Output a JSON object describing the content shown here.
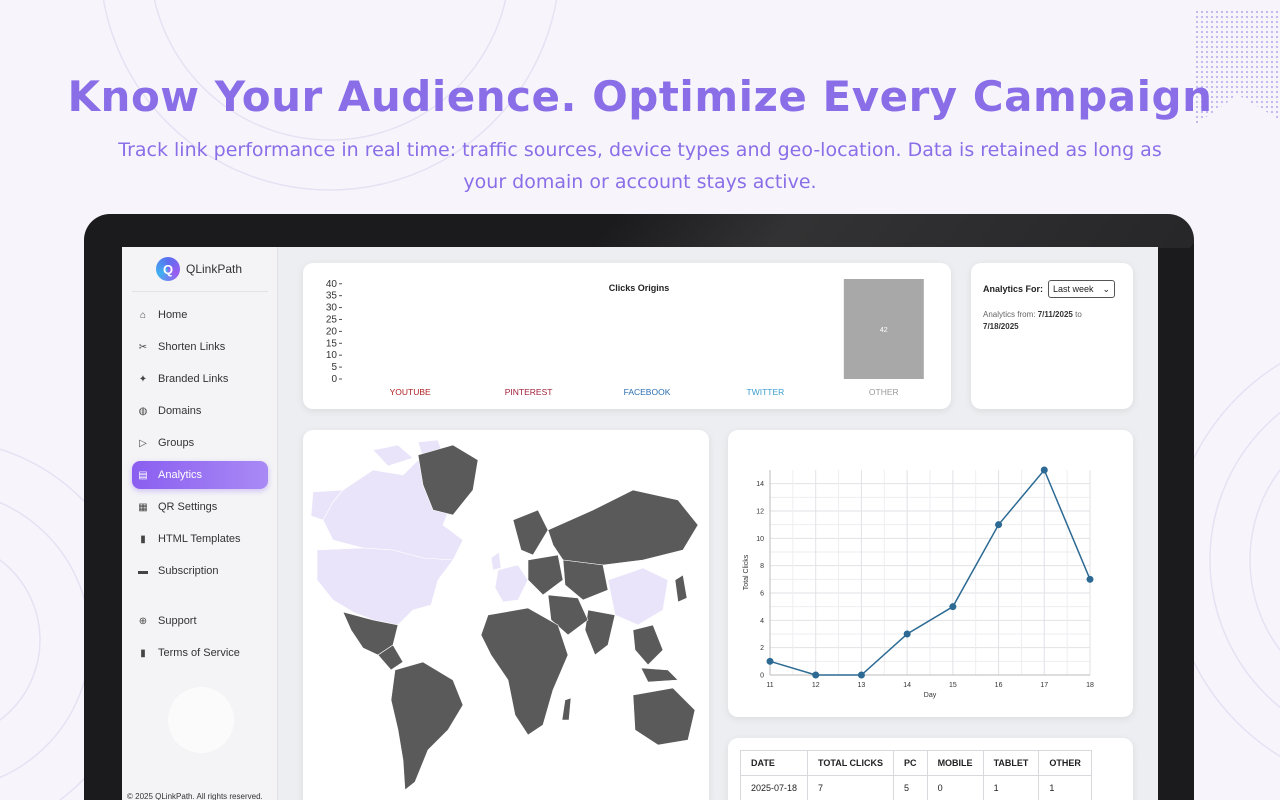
{
  "hero": {
    "title": "Know Your Audience. Optimize Every Campaign",
    "subtitle": "Track link performance in real time: traffic sources, device types and geo-location. Data is retained as long as your domain or account stays active."
  },
  "brand": {
    "logo_letter": "Q",
    "name": "QLinkPath"
  },
  "sidebar": {
    "items": [
      {
        "label": "Home",
        "icon": "home-icon",
        "glyph": "⌂"
      },
      {
        "label": "Shorten Links",
        "icon": "scissors-icon",
        "glyph": "✂"
      },
      {
        "label": "Branded Links",
        "icon": "magic-wand-icon",
        "glyph": "✦"
      },
      {
        "label": "Domains",
        "icon": "globe-icon",
        "glyph": "◍"
      },
      {
        "label": "Groups",
        "icon": "tag-icon",
        "glyph": "▷"
      },
      {
        "label": "Analytics",
        "icon": "chart-icon",
        "glyph": "▤"
      },
      {
        "label": "QR Settings",
        "icon": "qr-icon",
        "glyph": "▦"
      },
      {
        "label": "HTML Templates",
        "icon": "file-icon",
        "glyph": "▮"
      },
      {
        "label": "Subscription",
        "icon": "card-icon",
        "glyph": "▬"
      }
    ],
    "secondary": [
      {
        "label": "Support",
        "icon": "lifebuoy-icon",
        "glyph": "⊕"
      },
      {
        "label": "Terms of Service",
        "icon": "document-icon",
        "glyph": "▮"
      }
    ],
    "active": "Analytics",
    "footer": "© 2025 QLinkPath. All rights reserved."
  },
  "filter": {
    "label": "Analytics For:",
    "selected": "Last week",
    "range_prefix": "Analytics from:",
    "from": "7/11/2025",
    "to_word": "to",
    "to": "7/18/2025"
  },
  "chart_data": [
    {
      "type": "bar",
      "title": "Clicks Origins",
      "categories": [
        "YOUTUBE",
        "PINTEREST",
        "FACEBOOK",
        "TWITTER",
        "OTHER"
      ],
      "category_colors": [
        "#b02020",
        "#a0203a",
        "#2a6db0",
        "#3a9ed0",
        "#9a9a9a"
      ],
      "values": [
        0,
        0,
        0,
        0,
        42
      ],
      "data_labels": [
        "",
        "",
        "",
        "",
        "42"
      ],
      "yticks": [
        0,
        5,
        10,
        15,
        20,
        25,
        30,
        35,
        40
      ],
      "ylim": [
        0,
        42
      ],
      "bar_color": "#a8a8a8"
    },
    {
      "type": "line",
      "x": [
        11,
        12,
        13,
        14,
        15,
        16,
        17,
        18
      ],
      "series": [
        {
          "values": [
            1,
            0,
            0,
            3,
            5,
            11,
            15,
            7
          ]
        }
      ],
      "xlabel": "Day",
      "ylabel": "Total Clicks",
      "yticks": [
        0,
        2,
        4,
        6,
        8,
        10,
        12,
        14
      ],
      "ylim": [
        0,
        15
      ],
      "grid": true,
      "line_color": "#2c6a93"
    }
  ],
  "table": {
    "headers": [
      "DATE",
      "TOTAL CLICKS",
      "PC",
      "MOBILE",
      "TABLET",
      "OTHER"
    ],
    "rows": [
      [
        "2025-07-18",
        "7",
        "5",
        "0",
        "1",
        "1"
      ]
    ]
  },
  "map": {
    "highlight_color": "#e9e4fa",
    "base_color": "#5a5a5a"
  }
}
